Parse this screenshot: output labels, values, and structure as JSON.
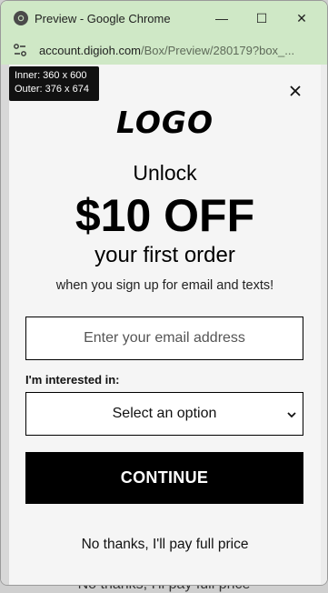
{
  "window": {
    "title": "Preview - Google Chrome",
    "minimize_glyph": "—",
    "maximize_glyph": "☐",
    "close_glyph": "✕"
  },
  "address": {
    "host": "account.digioh.com",
    "path": "/Box/Preview/280179?box_..."
  },
  "dims_tooltip": {
    "inner": "Inner: 360 x 600",
    "outer": "Outer: 376 x 674"
  },
  "popup": {
    "logo": "LOGO",
    "unlock": "Unlock",
    "offer": "$10 OFF",
    "first_order": "your first order",
    "subtitle": "when you sign up for email and texts!",
    "email_placeholder": "Enter your email address",
    "interest_label": "I'm interested in:",
    "select_value": "Select an option",
    "continue_label": "CONTINUE",
    "no_thanks": "No thanks, I'll pay full price"
  },
  "background_page": {
    "text": "No thanks, I'll pay full price"
  },
  "colors": {
    "titlebar": "#cfe8c6",
    "button": "#000000"
  }
}
